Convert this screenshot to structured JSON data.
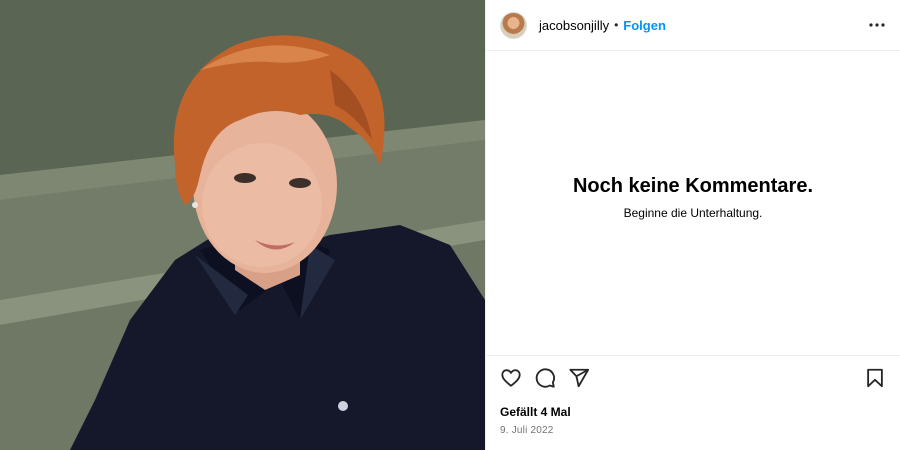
{
  "post": {
    "image_alt": "Porträt einer Frau mit kurzen roten Haaren in dunkler Bluse",
    "author": {
      "username": "jacobsonjilly",
      "separator": "•",
      "follow_label": "Folgen"
    },
    "comments_empty": {
      "title": "Noch keine Kommentare.",
      "subtitle": "Beginne die Unterhaltung."
    },
    "actions": {
      "like_icon": "heart-icon",
      "comment_icon": "comment-icon",
      "share_icon": "paper-plane-icon",
      "save_icon": "bookmark-icon",
      "more_icon": "more-options-icon"
    },
    "likes_text": "Gefällt 4 Mal",
    "date_text": "9. Juli 2022"
  },
  "colors": {
    "accent": "#0095f6",
    "divider": "#efefef",
    "muted_text": "#737373"
  }
}
